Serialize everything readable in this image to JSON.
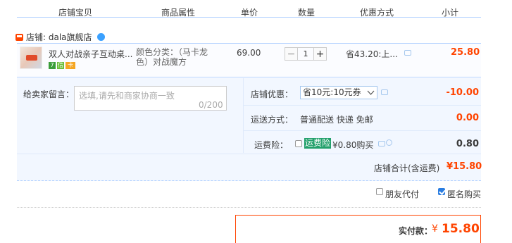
{
  "header": {
    "col_shop_item": "店铺宝贝",
    "col_attrs": "商品属性",
    "col_price": "单价",
    "col_qty": "数量",
    "col_discount": "优惠方式",
    "col_subtotal": "小计"
  },
  "shop": {
    "label": "店铺: dala旗舰店"
  },
  "item": {
    "title": "双人对战亲子互动桌...",
    "badges": [
      "7",
      "信",
      "卡"
    ],
    "attr_line1": "颜色分类：（马卡龙",
    "attr_line2": "色）对战魔方",
    "price": "69.00",
    "quantity": "1",
    "discount_text": "省43.20:上...",
    "subtotal": "25.80"
  },
  "memo": {
    "label": "给卖家留言：",
    "placeholder": "选填,请先和商家协商一致",
    "count": "0/200"
  },
  "shop_coupon": {
    "label": "店铺优惠：",
    "selected": "省10元:10元券",
    "amount": "-10.00"
  },
  "shipping": {
    "label": "运送方式：",
    "value": "普通配送 快递 免邮",
    "amount": "0.00"
  },
  "insurance": {
    "label": "运费险：",
    "tag": "运费险",
    "price_text": "¥0.80购买",
    "amount": "0.80"
  },
  "shop_total": {
    "label": "店铺合计(含运费)",
    "amount": "¥15.80"
  },
  "options": {
    "friend_pay": "朋友代付",
    "friend_pay_checked": false,
    "anonymous": "匿名购买",
    "anonymous_checked": true
  },
  "payment": {
    "label": "实付款：",
    "currency": "¥",
    "amount": "15.80"
  },
  "colors": {
    "accent": "#ff4400",
    "border_blue": "#b2d1ff",
    "section_bg": "#f2f7ff",
    "insurance_green": "#22a06b"
  }
}
